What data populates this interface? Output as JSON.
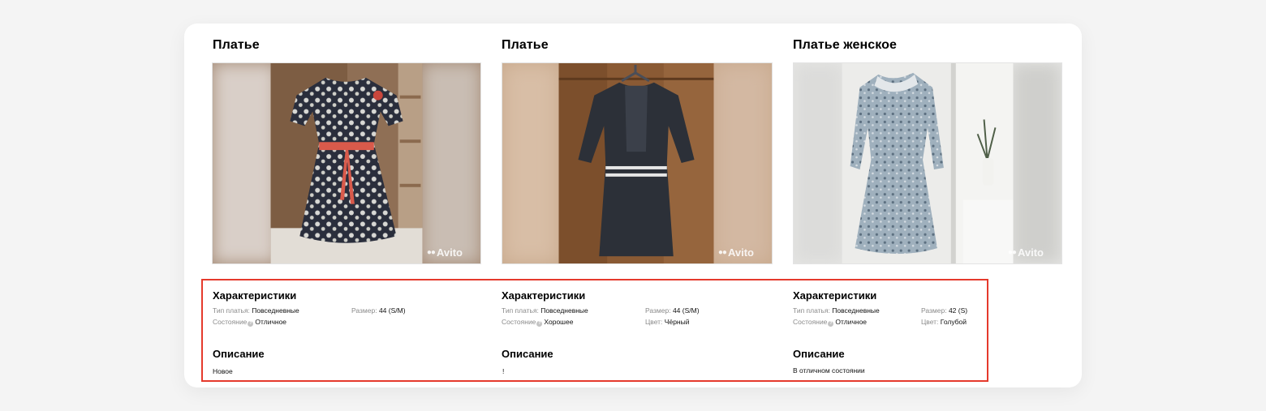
{
  "items": [
    {
      "title": "Платье",
      "watermark": "Avito",
      "characteristics_heading": "Характеристики",
      "type_label": "Тип платья:",
      "type_value": "Повседневные",
      "size_label": "Размер:",
      "size_value": "44 (S/M)",
      "condition_label": "Состояние",
      "condition_value": "Отличное",
      "color_label": "",
      "color_value": "",
      "description_heading": "Описание",
      "description_text": "Новое"
    },
    {
      "title": "Платье",
      "watermark": "Avito",
      "characteristics_heading": "Характеристики",
      "type_label": "Тип платья:",
      "type_value": "Повседневные",
      "size_label": "Размер:",
      "size_value": "44 (S/M)",
      "condition_label": "Состояние",
      "condition_value": "Хорошее",
      "color_label": "Цвет:",
      "color_value": "Чёрный",
      "description_heading": "Описание",
      "description_text": "!"
    },
    {
      "title": "Платье женское",
      "watermark": "Avito",
      "characteristics_heading": "Характеристики",
      "type_label": "Тип платья:",
      "type_value": "Повседневные",
      "size_label": "Размер:",
      "size_value": "42 (S)",
      "condition_label": "Состояние",
      "condition_value": "Отличное",
      "color_label": "Цвет:",
      "color_value": "Голубой",
      "description_heading": "Описание",
      "description_text": "В отличном состоянии"
    }
  ],
  "colors": {
    "highlight": "#e53a2c",
    "label_gray": "#8a8a8a"
  }
}
